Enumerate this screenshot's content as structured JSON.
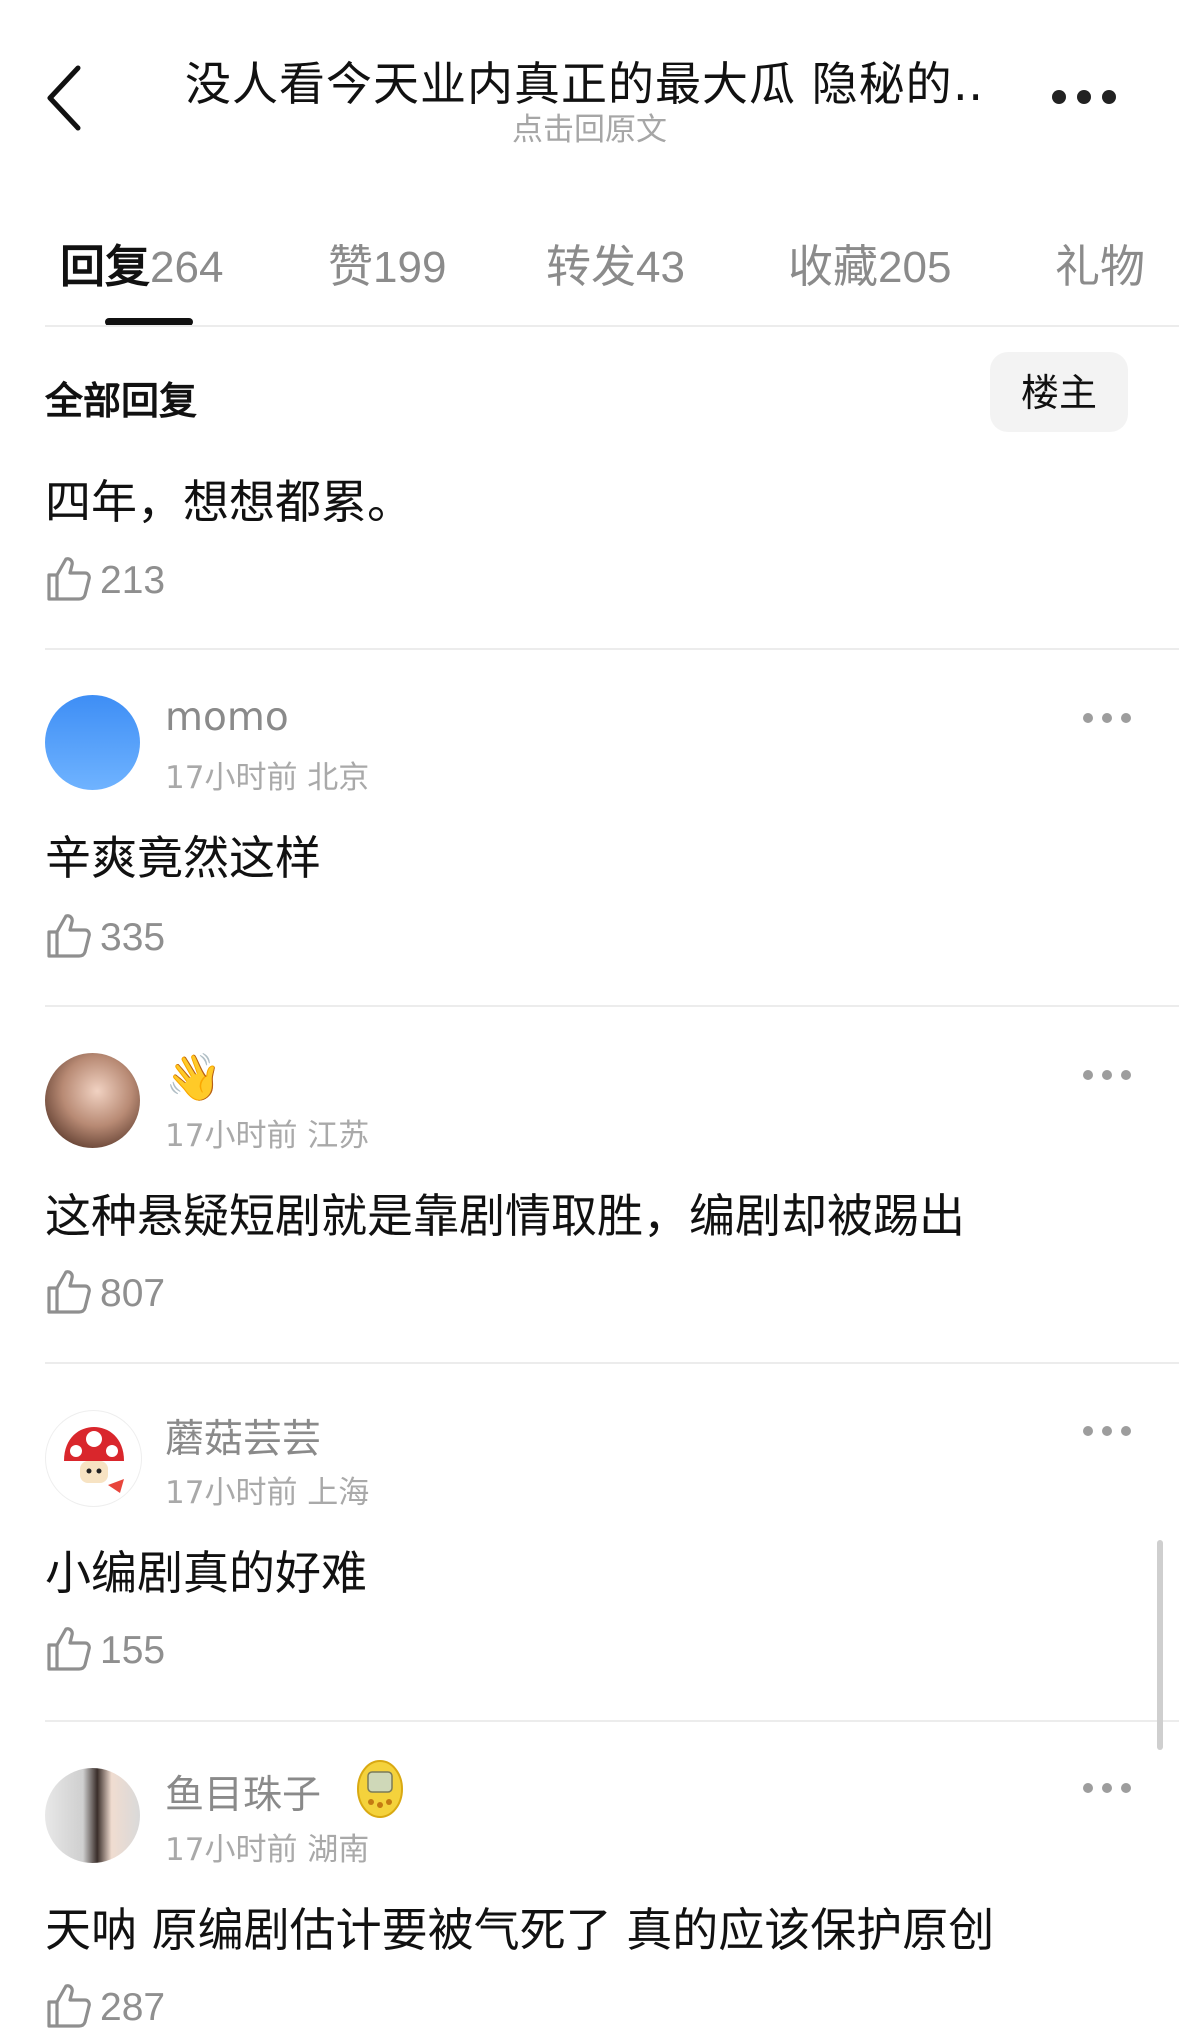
{
  "header": {
    "title": "没人看今天业内真正的最大瓜  隐秘的…",
    "subtitle": "点击回原文"
  },
  "tabs": [
    {
      "label": "回复",
      "count": "264",
      "active": true
    },
    {
      "label": "赞",
      "count": "199"
    },
    {
      "label": "转发",
      "count": "43"
    },
    {
      "label": "收藏",
      "count": "205"
    },
    {
      "label": "礼物",
      "count": ""
    }
  ],
  "filter": {
    "label": "全部回复",
    "op_button": "楼主"
  },
  "comments": [
    {
      "text": "四年，想想都累。",
      "likes": "213"
    },
    {
      "username": "momo",
      "meta": "17小时前 北京",
      "text": "辛爽竟然这样",
      "likes": "335",
      "avatar": "blue-gradient"
    },
    {
      "username": "",
      "emoji": "👋",
      "meta": "17小时前 江苏",
      "text": "这种悬疑短剧就是靠剧情取胜，编剧却被踢出",
      "likes": "807",
      "avatar": "photo"
    },
    {
      "username": "蘑菇芸芸",
      "meta": "17小时前 上海",
      "text": "小编剧真的好难",
      "likes": "155",
      "avatar": "mushroom"
    },
    {
      "username": "鱼目珠子",
      "badge": "tamagotchi-icon",
      "meta": "17小时前 湖南",
      "text": "天呐 原编剧估计要被气死了 真的应该保护原创",
      "likes": "287",
      "avatar": "photo-girl"
    }
  ],
  "colors": {
    "accent": "#111111",
    "muted": "#8a8a8a",
    "divider": "#ececec"
  }
}
